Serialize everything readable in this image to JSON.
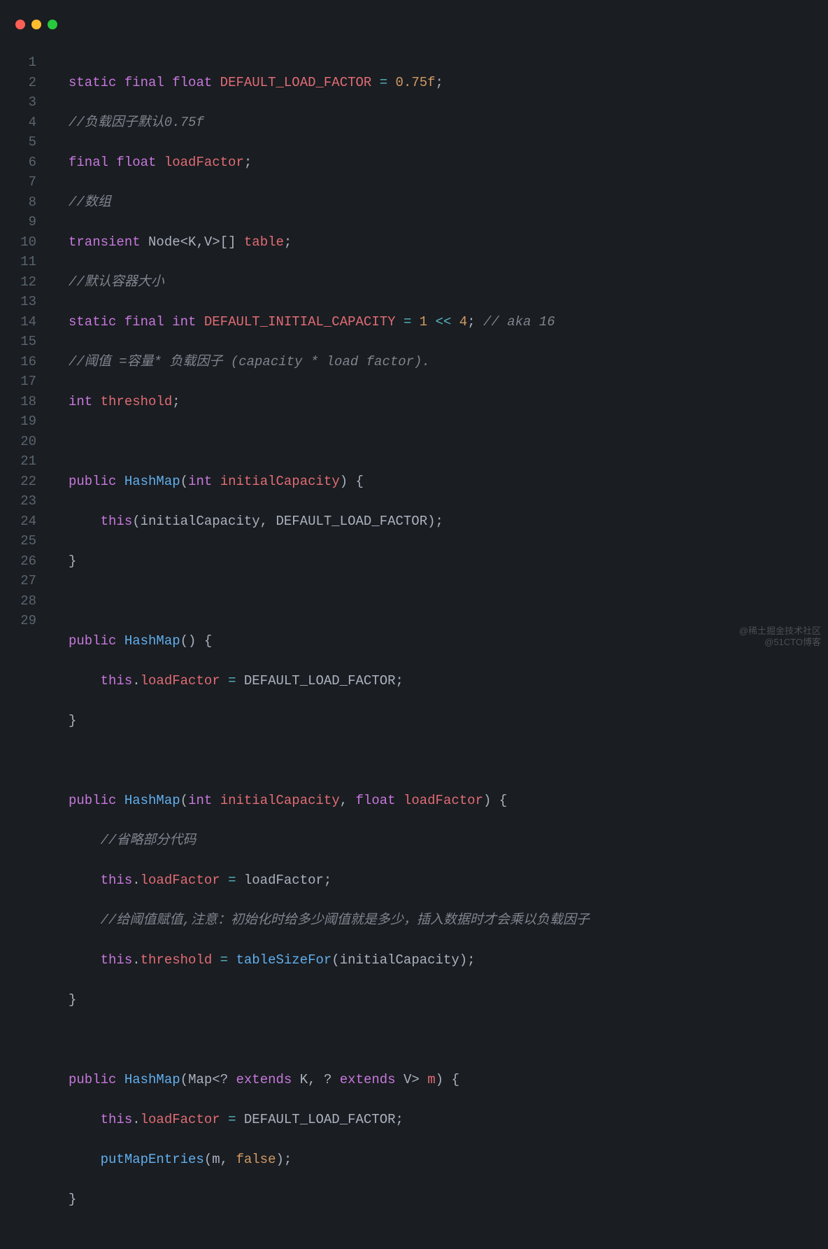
{
  "titlebar": {
    "dots": [
      "red",
      "yellow",
      "green"
    ]
  },
  "line_count": 29,
  "code": {
    "l1": {
      "t1": "static",
      "t2": "final",
      "t3": "float",
      "t4": "DEFAULT_LOAD_FACTOR",
      "t5": "=",
      "t6": "0.75f",
      "t7": ";"
    },
    "l2": {
      "c": "//负载因子默认0.75f"
    },
    "l3": {
      "t1": "final",
      "t2": "float",
      "t3": "loadFactor",
      "t4": ";"
    },
    "l4": {
      "c": "//数组"
    },
    "l5": {
      "t1": "transient",
      "t2": "Node",
      "t3": "<",
      "t4": "K",
      "t5": ",",
      "t6": "V",
      "t7": ">",
      "t8": "[]",
      "t9": "table",
      "t10": ";"
    },
    "l6": {
      "c": "//默认容器大小"
    },
    "l7": {
      "t1": "static",
      "t2": "final",
      "t3": "int",
      "t4": "DEFAULT_INITIAL_CAPACITY",
      "t5": "=",
      "t6": "1",
      "t7": "<<",
      "t8": "4",
      "t9": ";",
      "c": "// aka 16"
    },
    "l8": {
      "c": "//阈值 =容量* 负载因子 (capacity * load factor)."
    },
    "l9": {
      "t1": "int",
      "t2": "threshold",
      "t3": ";"
    },
    "l11": {
      "t1": "public",
      "t2": "HashMap",
      "t3": "(",
      "t4": "int",
      "t5": "initialCapacity",
      "t6": ")",
      "t7": "{"
    },
    "l12": {
      "t1": "this",
      "t2": "(",
      "t3": "initialCapacity",
      "t4": ",",
      "t5": "DEFAULT_LOAD_FACTOR",
      "t6": ")",
      "t7": ";"
    },
    "l13": {
      "t1": "}"
    },
    "l15": {
      "t1": "public",
      "t2": "HashMap",
      "t3": "()",
      "t4": "{"
    },
    "l16": {
      "t1": "this",
      "t2": ".",
      "t3": "loadFactor",
      "t4": "=",
      "t5": "DEFAULT_LOAD_FACTOR",
      "t6": ";"
    },
    "l17": {
      "t1": "}"
    },
    "l19": {
      "t1": "public",
      "t2": "HashMap",
      "t3": "(",
      "t4": "int",
      "t5": "initialCapacity",
      "t6": ",",
      "t7": "float",
      "t8": "loadFactor",
      "t9": ")",
      "t10": "{"
    },
    "l20": {
      "c": "//省略部分代码"
    },
    "l21": {
      "t1": "this",
      "t2": ".",
      "t3": "loadFactor",
      "t4": "=",
      "t5": "loadFactor",
      "t6": ";"
    },
    "l22": {
      "c": "//给阈值赋值,注意：初始化时给多少阈值就是多少，插入数据时才会乘以负载因子"
    },
    "l23": {
      "t1": "this",
      "t2": ".",
      "t3": "threshold",
      "t4": "=",
      "t5": "tableSizeFor",
      "t6": "(",
      "t7": "initialCapacity",
      "t8": ")",
      "t9": ";"
    },
    "l24": {
      "t1": "}"
    },
    "l26": {
      "t1": "public",
      "t2": "HashMap",
      "t3": "(",
      "t4": "Map",
      "t5": "<",
      "t6": "?",
      "t7": "extends",
      "t8": "K",
      "t9": ",",
      "t10": "?",
      "t11": "extends",
      "t12": "V",
      "t13": ">",
      "t14": "m",
      "t15": ")",
      "t16": "{"
    },
    "l27": {
      "t1": "this",
      "t2": ".",
      "t3": "loadFactor",
      "t4": "=",
      "t5": "DEFAULT_LOAD_FACTOR",
      "t6": ";"
    },
    "l28": {
      "t1": "putMapEntries",
      "t2": "(",
      "t3": "m",
      "t4": ",",
      "t5": "false",
      "t6": ")",
      "t7": ";"
    },
    "l29": {
      "t1": "}"
    }
  },
  "watermark": {
    "l1": "@稀土掘金技术社区",
    "l2": "@51CTO博客"
  }
}
